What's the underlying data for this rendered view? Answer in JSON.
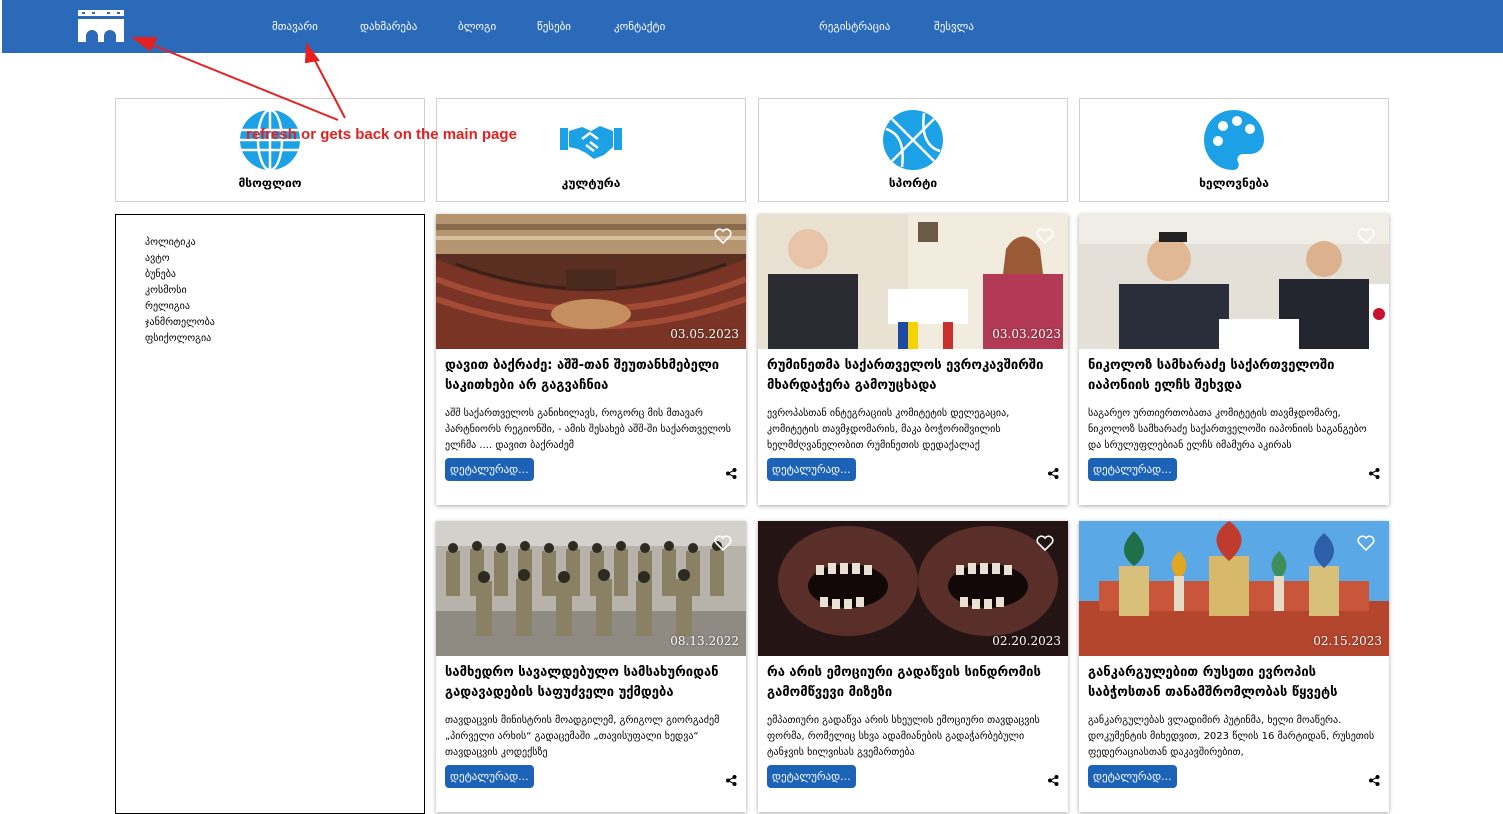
{
  "nav": {
    "logo_icon": "bridge-icon",
    "links": [
      "მთავარი",
      "დახმარება",
      "ბლოგი",
      "წესები",
      "კონტაქტი"
    ],
    "auth": [
      "რეგისტრაცია",
      "შესვლა"
    ]
  },
  "categories": [
    {
      "label": "მსოფლიო",
      "icon": "globe-icon"
    },
    {
      "label": "კულტურა",
      "icon": "handshake-icon"
    },
    {
      "label": "სპორტი",
      "icon": "basketball-icon"
    },
    {
      "label": "ხელოვნება",
      "icon": "palette-icon"
    }
  ],
  "sidebar": {
    "items": [
      "პოლიტიკა",
      "ავტო",
      "ბუნება",
      "კოსმოსი",
      "რელიგია",
      "ჯანმრთელობა",
      "ფსიქოლოგია"
    ]
  },
  "cards": [
    {
      "date": "03.05.2023",
      "title": "დავით ბაქრაძე: აშშ-თან შეუთანხმებელი საკითხები არ გაგვაჩნია",
      "text": "აშშ საქართველოს განიხილავს, როგორც მის მთავარ პარტნიორს რეგიონში, - ამის შესახებ აშშ-ში საქართველოს ელჩმა .... დავით ბაქრაძემ",
      "more": "დეტალურად...",
      "image": "parliament-chamber"
    },
    {
      "date": "03.03.2023",
      "title": "რუმინეთმა საქართველოს ევროკავშირში მხარდაჭერა გამოუცხადა",
      "text": "ევროპასთან ინტეგრაციის კომიტეტის დელეგაცია, კომიტეტის თავმჯდომარის, მაკა ბოჭორიშვილის ხელმძღვანელობით რუმინეთის დედაქალაქ",
      "more": "დეტალურად...",
      "image": "officials-handshake"
    },
    {
      "date": "",
      "title": "ნიკოლოზ სამხარაძე საქართველოში იაპონიის ელჩს შეხვდა",
      "text": "საგარეო ურთიერთობათა კომიტეტის თავმჯდომარე, ნიკოლოზ სამხარაძე საქართველოში იაპონიის საგანგებო და სრულუფლებიან ელჩს იმამურა აკირას",
      "more": "დეტალურად...",
      "image": "diplomat-meeting"
    },
    {
      "date": "08.13.2022",
      "title": "სამხედრო სავალდებულო სამსახურიდან გადავადების საფუძველი უქმდება",
      "text": "თავდაცვის მინისტრის მოადგილემ, გრიგოლ გიორგაძემ „პირველი არხის“ გადაცემაში „თავისუფალი ხედვა“ თავდაცვის კოდექსზე",
      "more": "დეტალურად...",
      "image": "soldiers-formation"
    },
    {
      "date": "02.20.2023",
      "title": "რა არის ემოციური გადაწვის სინდრომის გამომწვევი მიზეზი",
      "text": "ემპათიური გადაწვა არის სხეულის ემოციური თავდაცვის ფორმა, რომელიც სხვა ადამიანების გადაჭარბებული ტანჯვის ხილვისას გვემართება",
      "more": "დეტალურად...",
      "image": "screaming-faces"
    },
    {
      "date": "02.15.2023",
      "title": "განკარგულებით რუსეთი ევროპის საბჭოსთან თანამშრომლობას წყვეტს",
      "text": "განკარგულებას ვლადიმირ პუტინმა, ხელი მოაწერა. დოკუმენტის მიხედვით, 2023 წლის 16 მარტიდან, რუსეთის ფედერაციასთან დაკავშირებით,",
      "more": "დეტალურად...",
      "image": "moscow-cathedral"
    }
  ],
  "annotation": {
    "text": "refresh or gets back on the main page",
    "color": "#e52020"
  },
  "colors": {
    "brand": "#2a6ab9",
    "icon": "#1ca1e6",
    "button": "#1c63b8"
  }
}
